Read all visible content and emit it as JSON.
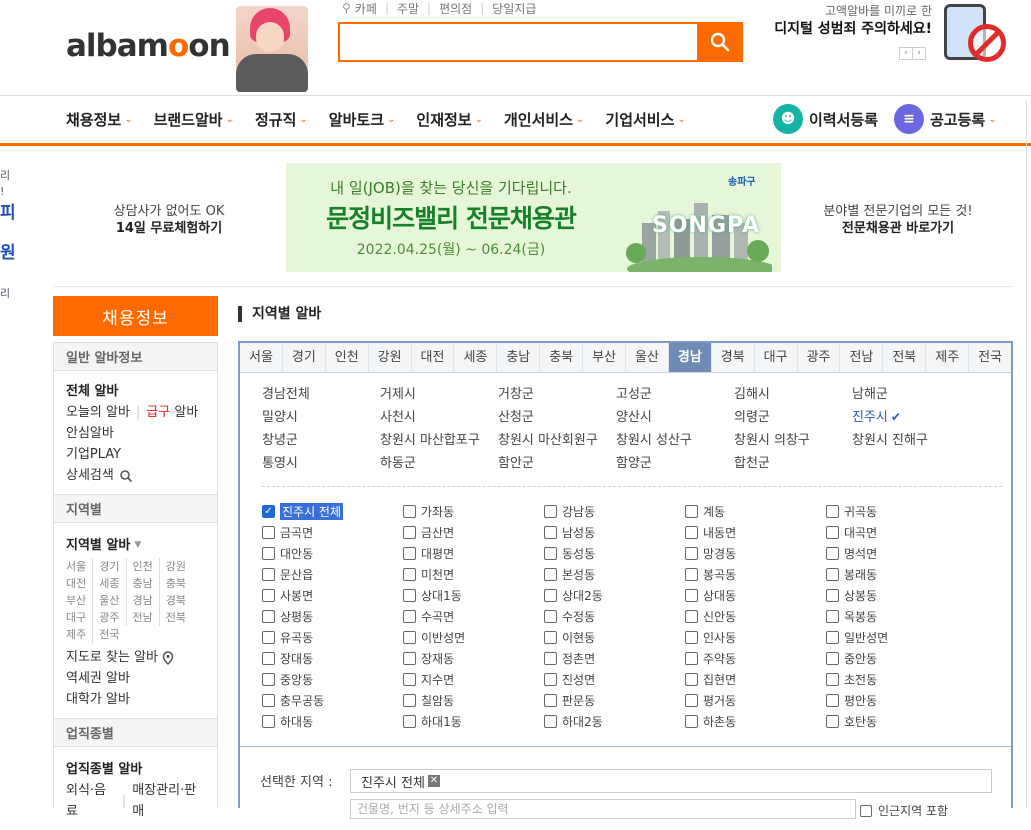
{
  "header": {
    "logo_text_a": "alba",
    "logo_text_o": "m",
    "logo_text_b": "on",
    "quick_links": [
      "카페",
      "주말",
      "편의점",
      "당일지급"
    ],
    "search_placeholder": "",
    "promo_line1": "고액알바를 미끼로 한",
    "promo_line2": "디지털 성범죄 주의하세요!",
    "promo_prev": "‹",
    "promo_next": "›"
  },
  "gnb": {
    "items": [
      "채용정보",
      "브랜드알바",
      "정규직",
      "알바토크",
      "인재정보",
      "개인서비스",
      "기업서비스"
    ],
    "resume_button": "이력서등록",
    "post_button": "공고등록"
  },
  "left_strip": [
    "리",
    "!",
    "피",
    "원",
    "리"
  ],
  "banner": {
    "left_line1": "상담사가 없어도 OK",
    "left_line2": "14일 무료체험하기",
    "center_line1": "내 일(JOB)을 찾는 당신을 기다립니다.",
    "center_line2": "문정비즈밸리 전문채용관",
    "center_line3": "2022.04.25(월) ~ 06.24(금)",
    "brand": "송파구",
    "city_text": "SONGPA",
    "right_line1": "분야별 전문기업의 모든 것!",
    "right_line2": "전문채용관 바로가기"
  },
  "left_nav": {
    "title": "채용정보",
    "sec1_title": "일반 알바정보",
    "all_alba": "전체 알바",
    "today_alba": "오늘의 알바",
    "urgent_word": "급구",
    "urgent_alba": "알바",
    "safe_alba": "안심알바",
    "company_play": "기업PLAY",
    "detail_search": "상세검색",
    "sec2_title": "지역별",
    "region_alba": "지역별 알바",
    "regions": [
      "서울",
      "경기",
      "인천",
      "강원",
      "대전",
      "세종",
      "충남",
      "충북",
      "부산",
      "울산",
      "경남",
      "경북",
      "대구",
      "광주",
      "전남",
      "전북",
      "제주",
      "전국"
    ],
    "map_alba": "지도로 찾는 알바",
    "station_alba": "역세권 알바",
    "univ_alba": "대학가 알바",
    "sec3_title": "업직종별",
    "job_alba": "업직종별 알바",
    "job_item1": "외식·음료",
    "job_item2": "매장관리·판매"
  },
  "main": {
    "title": "지역별 알바",
    "tabs": [
      "서울",
      "경기",
      "인천",
      "강원",
      "대전",
      "세종",
      "충남",
      "충북",
      "부산",
      "울산",
      "경남",
      "경북",
      "대구",
      "광주",
      "전남",
      "전북",
      "제주",
      "전국"
    ],
    "active_tab": "경남",
    "cities": [
      "경남전체",
      "거제시",
      "거창군",
      "고성군",
      "김해시",
      "남해군",
      "밀양시",
      "사천시",
      "산청군",
      "양산시",
      "의령군",
      "진주시",
      "창녕군",
      "창원시 마산합포구",
      "창원시 마산회원구",
      "창원시 성산구",
      "창원시 의창구",
      "창원시 진해구",
      "통영시",
      "하동군",
      "함안군",
      "함양군",
      "합천군"
    ],
    "selected_city": "진주시",
    "dongs": [
      "진주시 전체",
      "가좌동",
      "강남동",
      "계동",
      "귀곡동",
      "금곡면",
      "금산면",
      "남성동",
      "내동면",
      "대곡면",
      "대안동",
      "대평면",
      "동성동",
      "망경동",
      "명석면",
      "문산읍",
      "미천면",
      "본성동",
      "봉곡동",
      "봉래동",
      "사봉면",
      "상대1동",
      "상대2동",
      "상대동",
      "상봉동",
      "상평동",
      "수곡면",
      "수정동",
      "신안동",
      "옥봉동",
      "유곡동",
      "이반성면",
      "이현동",
      "인사동",
      "일반성면",
      "장대동",
      "장재동",
      "정촌면",
      "주약동",
      "중안동",
      "중앙동",
      "지수면",
      "진성면",
      "집현면",
      "초전동",
      "충무공동",
      "칠암동",
      "판문동",
      "평거동",
      "평안동",
      "하대동",
      "하대1동",
      "하대2동",
      "하촌동",
      "호탄동"
    ],
    "checked_dong": "진주시 전체",
    "selected_label": "선택한 지역 :",
    "selected_chip": "진주시 전체",
    "chip_remove": "✕",
    "address_placeholder": "건물명, 번지 등 상세주소 입력",
    "include_label": "인근지역 포함"
  }
}
